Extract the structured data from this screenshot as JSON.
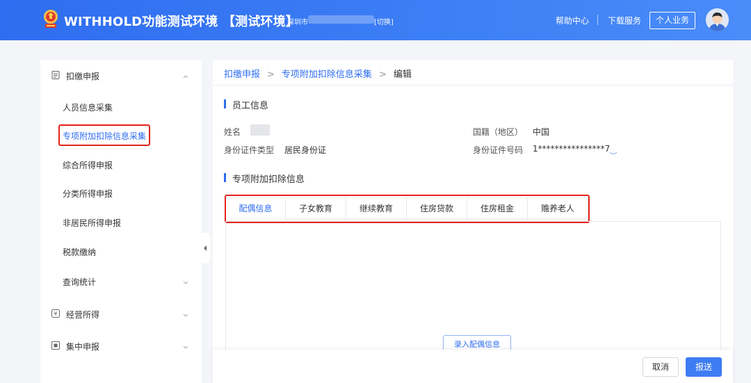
{
  "header": {
    "app_title": "WITHHOLD功能测试环境 【测试环境】",
    "city": "深圳市",
    "switch_label": "[切换]",
    "help_center": "帮助中心",
    "download_service": "下载服务",
    "personal_business": "个人业务",
    "icons": {
      "logo": "tax-emblem-icon",
      "avatar": "user-avatar-icon"
    },
    "colors": {
      "bar": "#2f6df0"
    }
  },
  "sidebar": {
    "groups": [
      {
        "label": "扣缴申报",
        "icon": "form-icon",
        "expanded": true
      },
      {
        "label": "经营所得",
        "icon": "business-icon",
        "expanded": false
      },
      {
        "label": "集中申报",
        "icon": "centralized-icon",
        "expanded": false
      }
    ],
    "items": [
      {
        "label": "人员信息采集"
      },
      {
        "label": "专项附加扣除信息采集",
        "active": true
      },
      {
        "label": "综合所得申报"
      },
      {
        "label": "分类所得申报"
      },
      {
        "label": "非居民所得申报"
      },
      {
        "label": "税款缴纳"
      },
      {
        "label": "查询统计"
      }
    ]
  },
  "breadcrumb": {
    "items": [
      "扣缴申报",
      "专项附加扣除信息采集",
      "编辑"
    ],
    "separator": ">"
  },
  "employee": {
    "section_title": "员工信息",
    "name_label": "姓名",
    "nationality_label": "国籍（地区）",
    "nationality_value": "中国",
    "id_type_label": "身份证件类型",
    "id_type_value": "居民身份证",
    "id_number_label": "身份证件号码",
    "id_number_value": "1****************7"
  },
  "deduction": {
    "section_title": "专项附加扣除信息",
    "tabs": [
      "配偶信息",
      "子女教育",
      "继续教育",
      "住房贷款",
      "住房租金",
      "赡养老人"
    ],
    "active_tab": 0,
    "add_button": "录入配偶信息"
  },
  "footer": {
    "cancel": "取消",
    "submit": "报送"
  },
  "colors": {
    "accent": "#2f6df0",
    "highlight_box": "#e2231a"
  }
}
